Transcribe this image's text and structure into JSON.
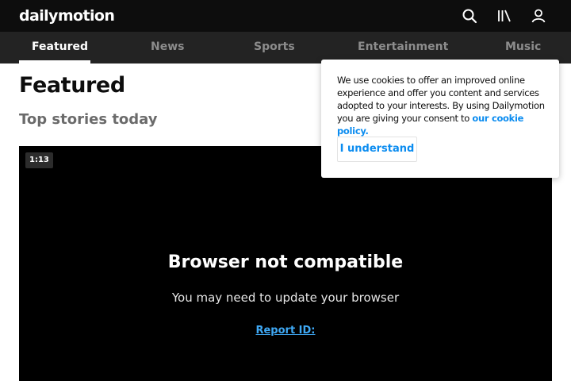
{
  "header": {
    "logo_text": "dailymotion",
    "icons": [
      "search-icon",
      "library-icon",
      "user-icon"
    ]
  },
  "nav": {
    "tabs": [
      {
        "label": "Featured",
        "active": true
      },
      {
        "label": "News",
        "active": false
      },
      {
        "label": "Sports",
        "active": false
      },
      {
        "label": "Entertainment",
        "active": false
      },
      {
        "label": "Music",
        "active": false
      }
    ]
  },
  "main": {
    "title": "Featured",
    "section_title": "Top stories today"
  },
  "player": {
    "duration": "1:13",
    "error_title": "Browser not compatible",
    "error_message": "You may need to update your browser",
    "report_label": "Report ID:"
  },
  "cookie": {
    "text": "We use cookies to offer an improved online experience and offer you content and services adopted to your interests. By using Dailymotion you are giving your consent to",
    "link_text": "our cookie policy.",
    "button_label": "I understand"
  },
  "colors": {
    "header_bg": "#0d0d0d",
    "nav_bg": "#232323",
    "accent": "#0b8cf0",
    "report_link": "#3fa9f5"
  }
}
